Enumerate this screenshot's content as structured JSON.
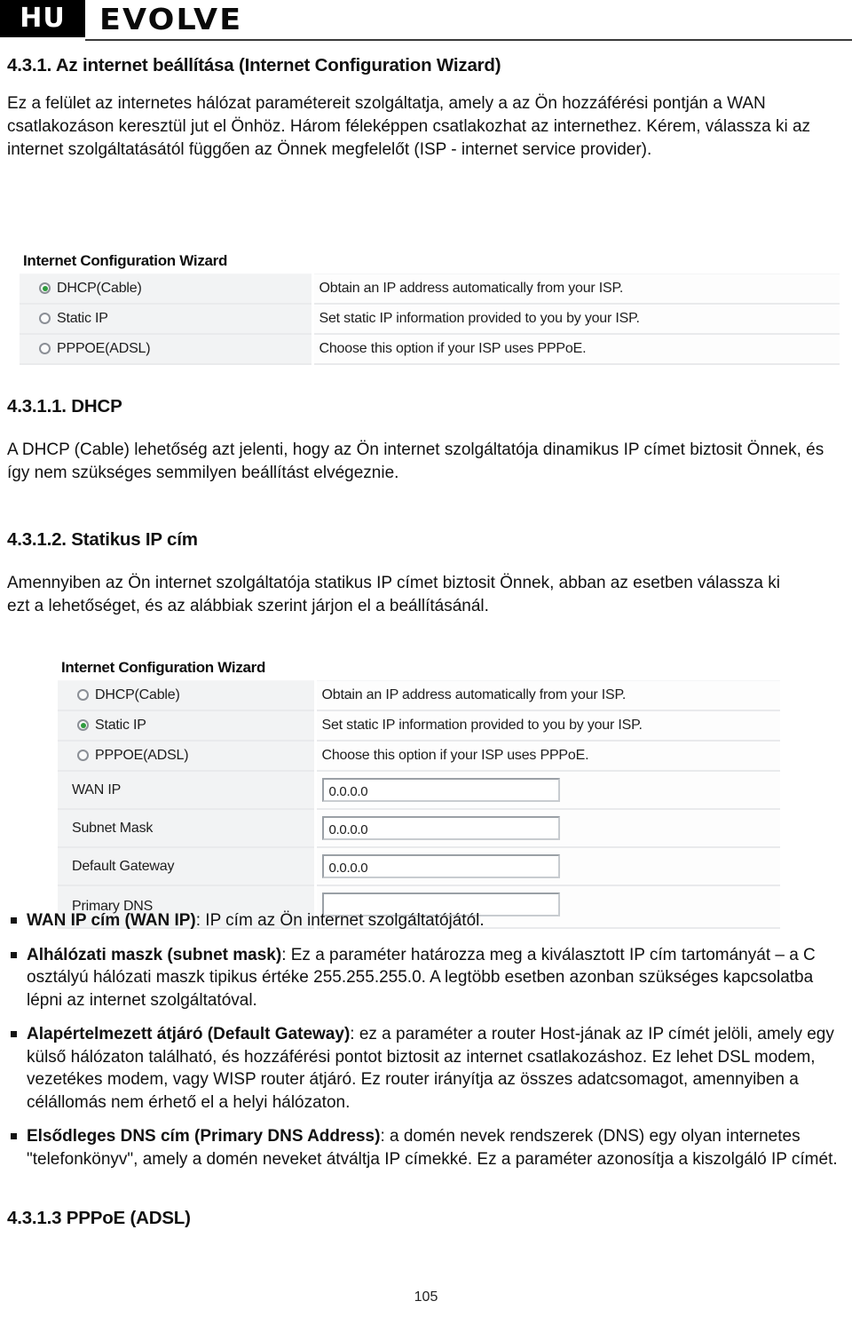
{
  "header": {
    "lang_badge": "HU",
    "brand": "EVOLVE"
  },
  "headings": {
    "main": "4.3.1. Az internet beállítása (Internet Configuration Wizard)",
    "dhcp": "4.3.1.1. DHCP",
    "static_ip": "4.3.1.2. Statikus IP cím",
    "pppoe": "4.3.1.3 PPPoE (ADSL)"
  },
  "paragraphs": {
    "intro": "Ez a felület az internetes hálózat paramétereit szolgáltatja, amely a az Ön hozzáférési pontján a WAN csatlakozáson keresztül jut el Önhöz. Három féleképpen csatlakozhat az internethez. Kérem, válassza ki az internet szolgáltatásától függően az Önnek megfelelőt (ISP - internet service provider).",
    "dhcp": "A DHCP (Cable) lehetőség azt jelenti, hogy az Ön internet szolgáltatója dinamikus IP címet biztosit Önnek, és így nem szükséges semmilyen beállítást elvégeznie.",
    "static_ip": "Amennyiben az Ön internet szolgáltatója statikus IP címet biztosit Önnek, abban az esetben válassza ki ezt a lehetőséget, és az alábbiak szerint járjon el a beállításánál."
  },
  "screenshot_dhcp": {
    "title": "Internet Configuration Wizard",
    "selected_option": "DHCP(Cable)",
    "rows": [
      {
        "label": "DHCP(Cable)",
        "description": "Obtain an IP address automatically from your ISP.",
        "selected": true
      },
      {
        "label": "Static IP",
        "description": "Set static IP information provided to you by your ISP.",
        "selected": false
      },
      {
        "label": "PPPOE(ADSL)",
        "description": "Choose this option if your ISP uses PPPoE.",
        "selected": false
      }
    ]
  },
  "screenshot_static": {
    "title": "Internet Configuration Wizard",
    "selected_option": "Static IP",
    "rows": [
      {
        "label": "DHCP(Cable)",
        "description": "Obtain an IP address automatically from your ISP.",
        "selected": false
      },
      {
        "label": "Static IP",
        "description": "Set static IP information provided to you by your ISP.",
        "selected": true
      },
      {
        "label": "PPPOE(ADSL)",
        "description": "Choose this option if your ISP uses PPPoE.",
        "selected": false
      }
    ],
    "fields": [
      {
        "label": "WAN IP",
        "value": "0.0.0.0"
      },
      {
        "label": "Subnet Mask",
        "value": "0.0.0.0"
      },
      {
        "label": "Default Gateway",
        "value": "0.0.0.0"
      },
      {
        "label": "Primary DNS",
        "value": ""
      }
    ]
  },
  "bullets": [
    {
      "term": "WAN IP cím (WAN IP)",
      "text": ": IP cím az Ön internet szolgáltatójától."
    },
    {
      "term": "Alhálózati maszk (subnet mask)",
      "text": ": Ez a paraméter határozza meg a kiválasztott IP cím tartományát – a C osztályú hálózati maszk tipikus értéke 255.255.255.0. A legtöbb esetben azonban szükséges kapcsolatba lépni az internet szolgáltatóval."
    },
    {
      "term": "Alapértelmezett átjáró (Default Gateway)",
      "text": ": ez a paraméter a router Host-jának az IP címét jelöli, amely egy külső hálózaton található, és hozzáférési pontot biztosit az internet csatlakozáshoz. Ez lehet DSL modem, vezetékes modem, vagy WISP router átjáró. Ez router irányítja az összes adatcsomagot, amennyiben a célállomás nem érhető el a helyi hálózaton."
    },
    {
      "term": "Elsődleges DNS cím (Primary DNS Address)",
      "text": ": a domén nevek rendszerek (DNS) egy olyan internetes \"telefonkönyv\", amely a domén neveket átváltja IP címekké. Ez a paraméter azonosítja a kiszolgáló IP címét."
    }
  ],
  "footer": {
    "page_number": "105"
  }
}
